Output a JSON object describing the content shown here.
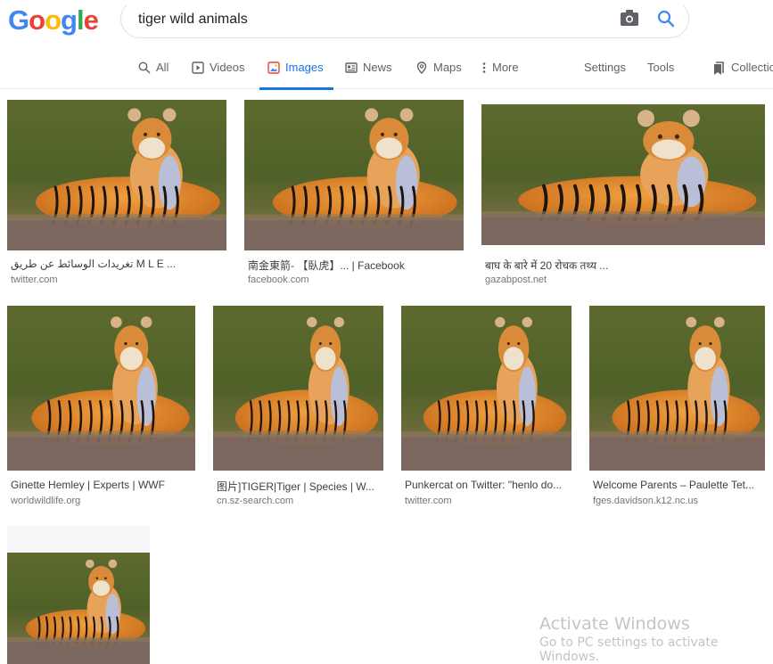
{
  "logo": {
    "letters": [
      "G",
      "o",
      "o",
      "g",
      "l",
      "e"
    ],
    "colors": [
      "#4285f4",
      "#ea4335",
      "#fbbc05",
      "#4285f4",
      "#34a853",
      "#ea4335"
    ]
  },
  "search": {
    "value": "tiger wild animals",
    "camera_icon": "camera-icon",
    "search_icon": "search-icon"
  },
  "tabs": {
    "items": [
      {
        "label": "All",
        "icon": "search-icon",
        "active": false
      },
      {
        "label": "Videos",
        "icon": "play-icon",
        "active": false
      },
      {
        "label": "Images",
        "icon": "image-icon",
        "active": true
      },
      {
        "label": "News",
        "icon": "news-icon",
        "active": false
      },
      {
        "label": "Maps",
        "icon": "map-pin-icon",
        "active": false
      },
      {
        "label": "More",
        "icon": "more-vert-icon",
        "active": false
      }
    ],
    "settings": "Settings",
    "tools": "Tools",
    "collections": "Collections"
  },
  "results": [
    {
      "caption": "تغريدات الوسائط عن طريق M L E ...",
      "source": "twitter.com"
    },
    {
      "caption": "南金東箭- 【臥虎】... | Facebook",
      "source": "facebook.com"
    },
    {
      "caption": "बाघ के बारे में 20 रोचक तथ्य ...",
      "source": "gazabpost.net"
    },
    {
      "caption": "Ginette Hemley | Experts | WWF",
      "source": "worldwildlife.org"
    },
    {
      "caption": "图片]TIGER|Tiger | Species | W...",
      "source": "cn.sz-search.com"
    },
    {
      "caption": "Punkercat on Twitter: \"henlo do...",
      "source": "twitter.com"
    },
    {
      "caption": "Welcome Parents – Paulette Tet...",
      "source": "fges.davidson.k12.nc.us"
    },
    {
      "caption": "",
      "source": ""
    }
  ],
  "watermark": {
    "title": "Activate Windows",
    "subtitle": "Go to PC settings to activate Windows."
  },
  "colors": {
    "accent": "#1a73e8",
    "tab_text": "#5f6368",
    "caption": "#3c4043",
    "source": "#70757a"
  }
}
